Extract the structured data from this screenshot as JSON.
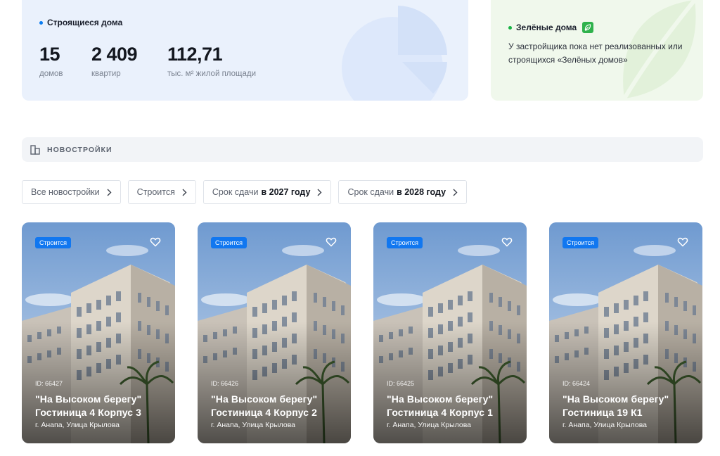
{
  "stats": {
    "title": "Строящиеся дома",
    "items": [
      {
        "value": "15",
        "label": "домов"
      },
      {
        "value": "2 409",
        "label": "квартир"
      },
      {
        "value": "112,71",
        "label": "тыс. м² жилой площади"
      }
    ]
  },
  "green": {
    "title": "Зелёные дома",
    "text": "У застройщика пока нет реализованных или строящихся «Зелёных домов»"
  },
  "section": {
    "icon": "building-icon",
    "label": "НОВОСТРОЙКИ"
  },
  "filters": [
    {
      "text": "Все новостройки",
      "bold": ""
    },
    {
      "text": "Строится",
      "bold": ""
    },
    {
      "text": "Срок сдачи",
      "bold": "в 2027 году"
    },
    {
      "text": "Срок сдачи",
      "bold": "в 2028 году"
    }
  ],
  "cards": [
    {
      "badge": "Строится",
      "id": "ID: 66427",
      "name_line1": "\"На Высоком берегу\"",
      "name_line2": "Гостиница 4 Корпус 3",
      "address": "г. Анапа, Улица Крылова"
    },
    {
      "badge": "Строится",
      "id": "ID: 66426",
      "name_line1": "\"На Высоком берегу\"",
      "name_line2": "Гостиница 4 Корпус 2",
      "address": "г. Анапа, Улица Крылова"
    },
    {
      "badge": "Строится",
      "id": "ID: 66425",
      "name_line1": "\"На Высоком берегу\"",
      "name_line2": "Гостиница 4 Корпус 1",
      "address": "г. Анапа, Улица Крылова"
    },
    {
      "badge": "Строится",
      "id": "ID: 66424",
      "name_line1": "\"На Высоком берегу\"",
      "name_line2": "Гостиница 19 К1",
      "address": "г. Анапа, Улица Крылова"
    }
  ],
  "colors": {
    "accent": "#1177f0",
    "green": "#2fb24c",
    "stats_bg": "#eaf1fc",
    "green_bg": "#f0f8ec"
  }
}
